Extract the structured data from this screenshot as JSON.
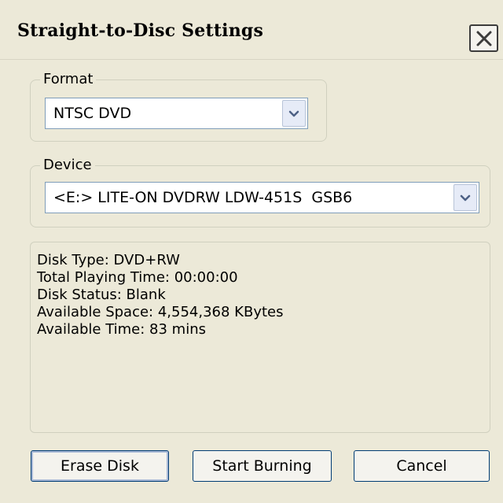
{
  "window": {
    "title": "Straight-to-Disc Settings"
  },
  "format": {
    "label": "Format",
    "selected": "NTSC DVD"
  },
  "device": {
    "label": "Device",
    "selected": "<E:> LITE-ON DVDRW LDW-451S  GSB6"
  },
  "disk_info": {
    "disk_type": "Disk Type: DVD+RW",
    "total_playing_time": "Total Playing Time: 00:00:00",
    "disk_status": "Disk Status: Blank",
    "available_space": "Available Space: 4,554,368 KBytes",
    "available_time": "Available Time: 83 mins"
  },
  "buttons": {
    "erase": "Erase Disk",
    "start": "Start Burning",
    "cancel": "Cancel"
  },
  "icons": {
    "close": "close-icon",
    "dropdown": "chevron-down-icon"
  },
  "colors": {
    "dialog_background": "#ece9d8",
    "combo_border": "#7f9db9",
    "button_border": "#003c74"
  }
}
